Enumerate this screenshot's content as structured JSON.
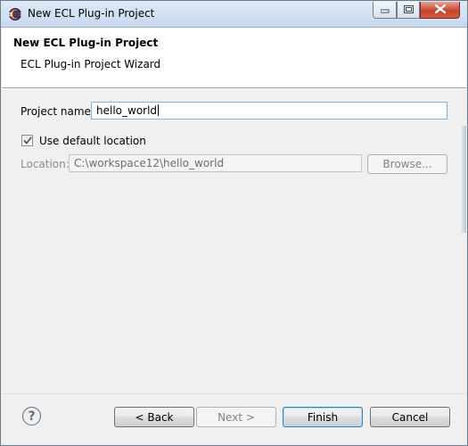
{
  "window": {
    "title": "New ECL Plug-in Project",
    "app_icon": "eclipse-icon",
    "controls": {
      "minimize": "minimize-icon",
      "maximize": "maximize-icon",
      "close": "close-icon"
    }
  },
  "header": {
    "title": "New ECL Plug-in Project",
    "description": "ECL Plug-in Project Wizard"
  },
  "form": {
    "project_name_label": "Project name:",
    "project_name_value": "hello_world",
    "use_default_label": "Use default location",
    "use_default_checked": true,
    "location_label": "Location:",
    "location_value": "C:\\workspace12\\hello_world",
    "browse_label": "Browse..."
  },
  "footer": {
    "help_icon": "help-icon",
    "back_label": "< Back",
    "next_label": "Next >",
    "finish_label": "Finish",
    "cancel_label": "Cancel"
  },
  "colors": {
    "dialog_bg": "#f0f0f0",
    "header_bg": "#ffffff",
    "title_bar": "#c8d9ee",
    "close_button": "#c7462f",
    "default_button_border": "#3c7fb1"
  }
}
